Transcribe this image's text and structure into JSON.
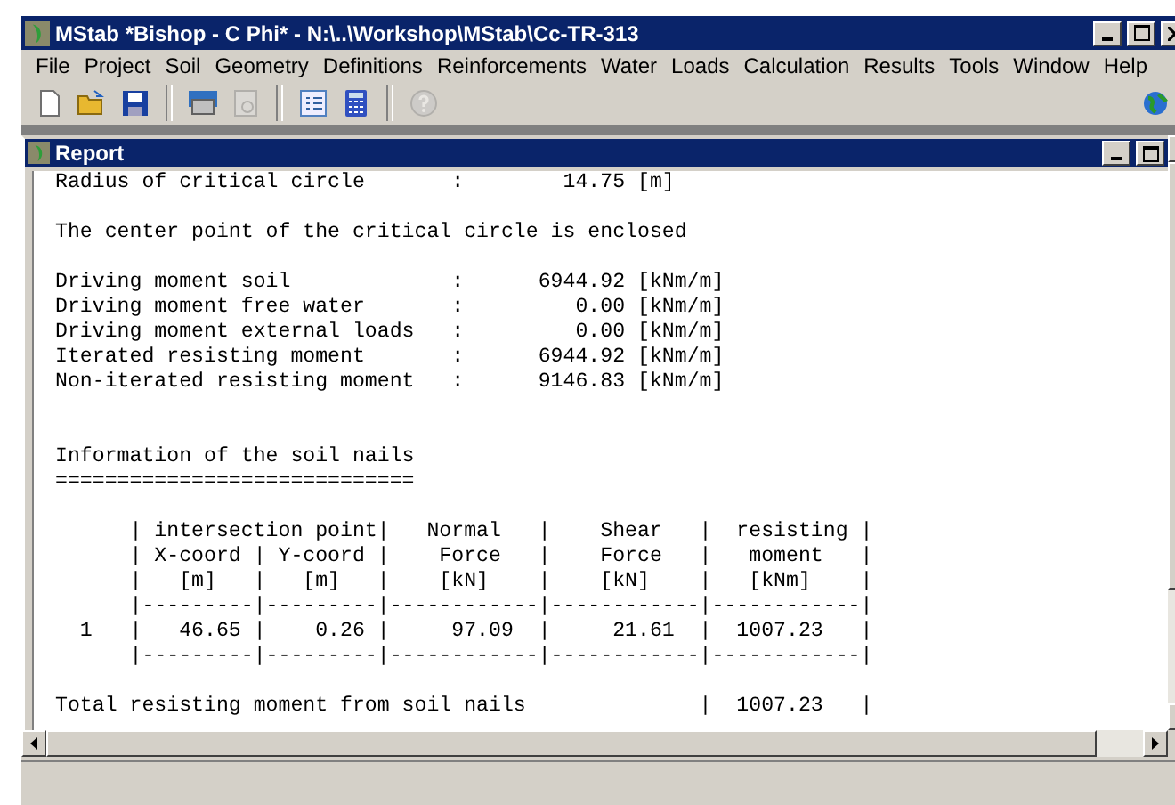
{
  "window": {
    "title": "MStab *Bishop - C Phi* - N:\\..\\Workshop\\MStab\\Cc-TR-313"
  },
  "menu": [
    "File",
    "Project",
    "Soil",
    "Geometry",
    "Definitions",
    "Reinforcements",
    "Water",
    "Loads",
    "Calculation",
    "Results",
    "Tools",
    "Window",
    "Help"
  ],
  "toolbar": [
    {
      "kind": "new",
      "disabled": false
    },
    {
      "kind": "open",
      "disabled": false
    },
    {
      "kind": "save",
      "disabled": false
    },
    {
      "kind": "separator"
    },
    {
      "kind": "print",
      "disabled": false
    },
    {
      "kind": "preview",
      "disabled": true
    },
    {
      "kind": "separator"
    },
    {
      "kind": "list",
      "disabled": false
    },
    {
      "kind": "calculator",
      "disabled": false
    },
    {
      "kind": "separator"
    },
    {
      "kind": "help",
      "disabled": true
    }
  ],
  "report": {
    "title": "Report",
    "blocks": [
      {
        "kind": "top",
        "lines": [
          "Radius of critical circle       :        14.75 [m]"
        ]
      },
      {
        "kind": "paragraph",
        "lines": [
          "The center point of the critical circle is enclosed"
        ]
      },
      {
        "kind": "paragraph",
        "lines": [
          "Driving moment soil             :      6944.92 [kNm/m]",
          "Driving moment free water       :         0.00 [kNm/m]",
          "Driving moment external loads   :         0.00 [kNm/m]",
          "Iterated resisting moment       :      6944.92 [kNm/m]",
          "Non-iterated resisting moment   :      9146.83 [kNm/m]"
        ]
      },
      {
        "kind": "section",
        "lines": [
          "Information of the soil nails",
          "============================="
        ]
      },
      {
        "kind": "paragraph",
        "lines": [
          "      | intersection point|   Normal   |    Shear   |  resisting |",
          "      | X-coord | Y-coord |    Force   |    Force   |   moment   |",
          "      |   [m]   |   [m]   |    [kN]    |    [kN]    |   [kNm]    |",
          "      |---------|---------|------------|------------|------------|",
          "  1   |   46.65 |    0.26 |     97.09  |     21.61  |  1007.23   |",
          "      |---------|---------|------------|------------|------------|"
        ]
      },
      {
        "kind": "paragraph",
        "lines": [
          "Total resisting moment from soil nails              |  1007.23   |"
        ]
      }
    ]
  }
}
